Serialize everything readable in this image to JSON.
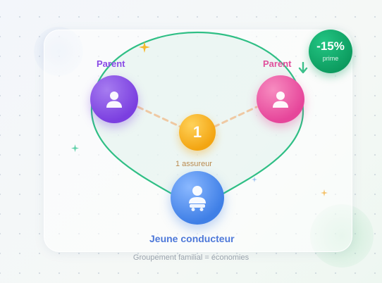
{
  "diagram": {
    "parent_left_label": "Parent",
    "parent_right_label": "Parent",
    "insurer_number": "1",
    "insurer_label": "1 assureur",
    "young_driver_label": "Jeune conducteur",
    "caption": "Groupement familial = économies",
    "discount": {
      "value": "-15%",
      "sub": "prime"
    }
  },
  "colors": {
    "parent_left": "#7b3fe0",
    "parent_right": "#e6459a",
    "insurer": "#f3a512",
    "young_driver": "#3f7fe6",
    "discount": "#0c9a5e",
    "family_loop": "#2fbf85",
    "dashed_link": "#efc9a3"
  },
  "icons": {
    "parent_left": "person-icon",
    "parent_right": "person-icon",
    "young_driver": "driver-icon",
    "arrow": "arrow-down-icon",
    "sparkles": "sparkle-icon"
  }
}
